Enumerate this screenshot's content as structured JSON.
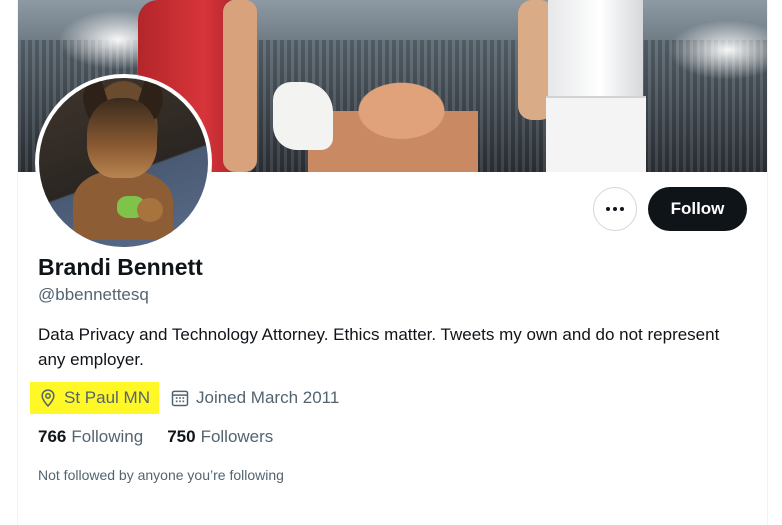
{
  "profile": {
    "name": "Brandi Bennett",
    "handle": "@bbennettesq",
    "bio": "Data Privacy and Technology Attorney. Ethics matter. Tweets my own and do not represent any employer.",
    "location": "St Paul MN",
    "joined": "Joined March 2011",
    "following_count": "766",
    "following_label": "Following",
    "followers_count": "750",
    "followers_label": "Followers",
    "not_followed_text": "Not followed by anyone you’re following"
  },
  "actions": {
    "follow_label": "Follow",
    "more_icon": "more-dots-icon"
  },
  "icons": {
    "location": "location-pin-icon",
    "calendar": "calendar-icon"
  },
  "colors": {
    "highlight": "#fff726",
    "follow_button_bg": "#0f1419",
    "secondary_text": "#536471"
  }
}
